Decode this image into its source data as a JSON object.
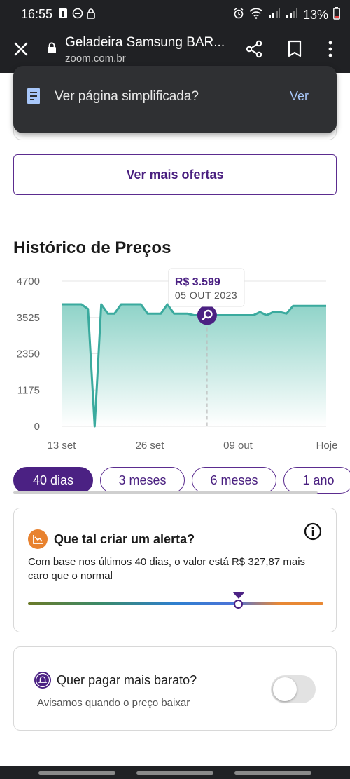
{
  "status_bar": {
    "time": "16:55",
    "battery": "13%"
  },
  "browser": {
    "title": "Geladeira Samsung BAR...",
    "url": "zoom.com.br"
  },
  "simplified_prompt": {
    "text": "Ver página simplificada?",
    "action": "Ver"
  },
  "offers": {
    "more_label": "Ver mais ofertas"
  },
  "history": {
    "title": "Histórico de Preços"
  },
  "chart_data": {
    "type": "area",
    "title": "",
    "y_ticks": [
      "4700",
      "3525",
      "2350",
      "1175",
      "0"
    ],
    "ylim": [
      0,
      4700
    ],
    "x_ticks": [
      "13 set",
      "26 set",
      "09 out",
      "Hoje"
    ],
    "x": [
      0,
      3,
      4,
      5,
      6,
      7,
      8,
      9,
      10,
      11,
      12,
      13,
      14,
      15,
      16,
      17,
      18,
      19,
      20,
      21,
      22,
      23,
      24,
      25,
      26,
      27,
      28,
      29,
      30,
      31,
      32,
      33,
      34,
      35,
      36,
      37,
      38,
      39,
      40
    ],
    "values": [
      3950,
      3950,
      3800,
      0,
      3950,
      3650,
      3650,
      3950,
      3950,
      3950,
      3950,
      3650,
      3650,
      3650,
      3950,
      3650,
      3650,
      3650,
      3599,
      3599,
      3599,
      3599,
      3599,
      3599,
      3599,
      3599,
      3599,
      3599,
      3700,
      3599,
      3700,
      3700,
      3650,
      3900,
      3900,
      3900,
      3900,
      3900,
      3900
    ],
    "tooltip": {
      "price": "R$ 3.599",
      "date": "05 OUT 2023"
    },
    "colors": {
      "line": "#3aaa9e",
      "fill_top": "#8fd3c8",
      "fill_bottom": "#ffffff",
      "marker": "#4b2183"
    },
    "grid": true
  },
  "periods": {
    "items": [
      "40 dias",
      "3 meses",
      "6 meses",
      "1 ano"
    ],
    "active": "40 dias"
  },
  "alert": {
    "title": "Que tal criar um alerta?",
    "text": "Com base nos últimos 40 dias, o valor está R$ 327,87 mais caro que o normal",
    "gauge_position": 0.71
  },
  "cheaper": {
    "title": "Quer pagar mais barato?",
    "subtitle": "Avisamos quando o preço baixar",
    "toggle_on": false
  }
}
